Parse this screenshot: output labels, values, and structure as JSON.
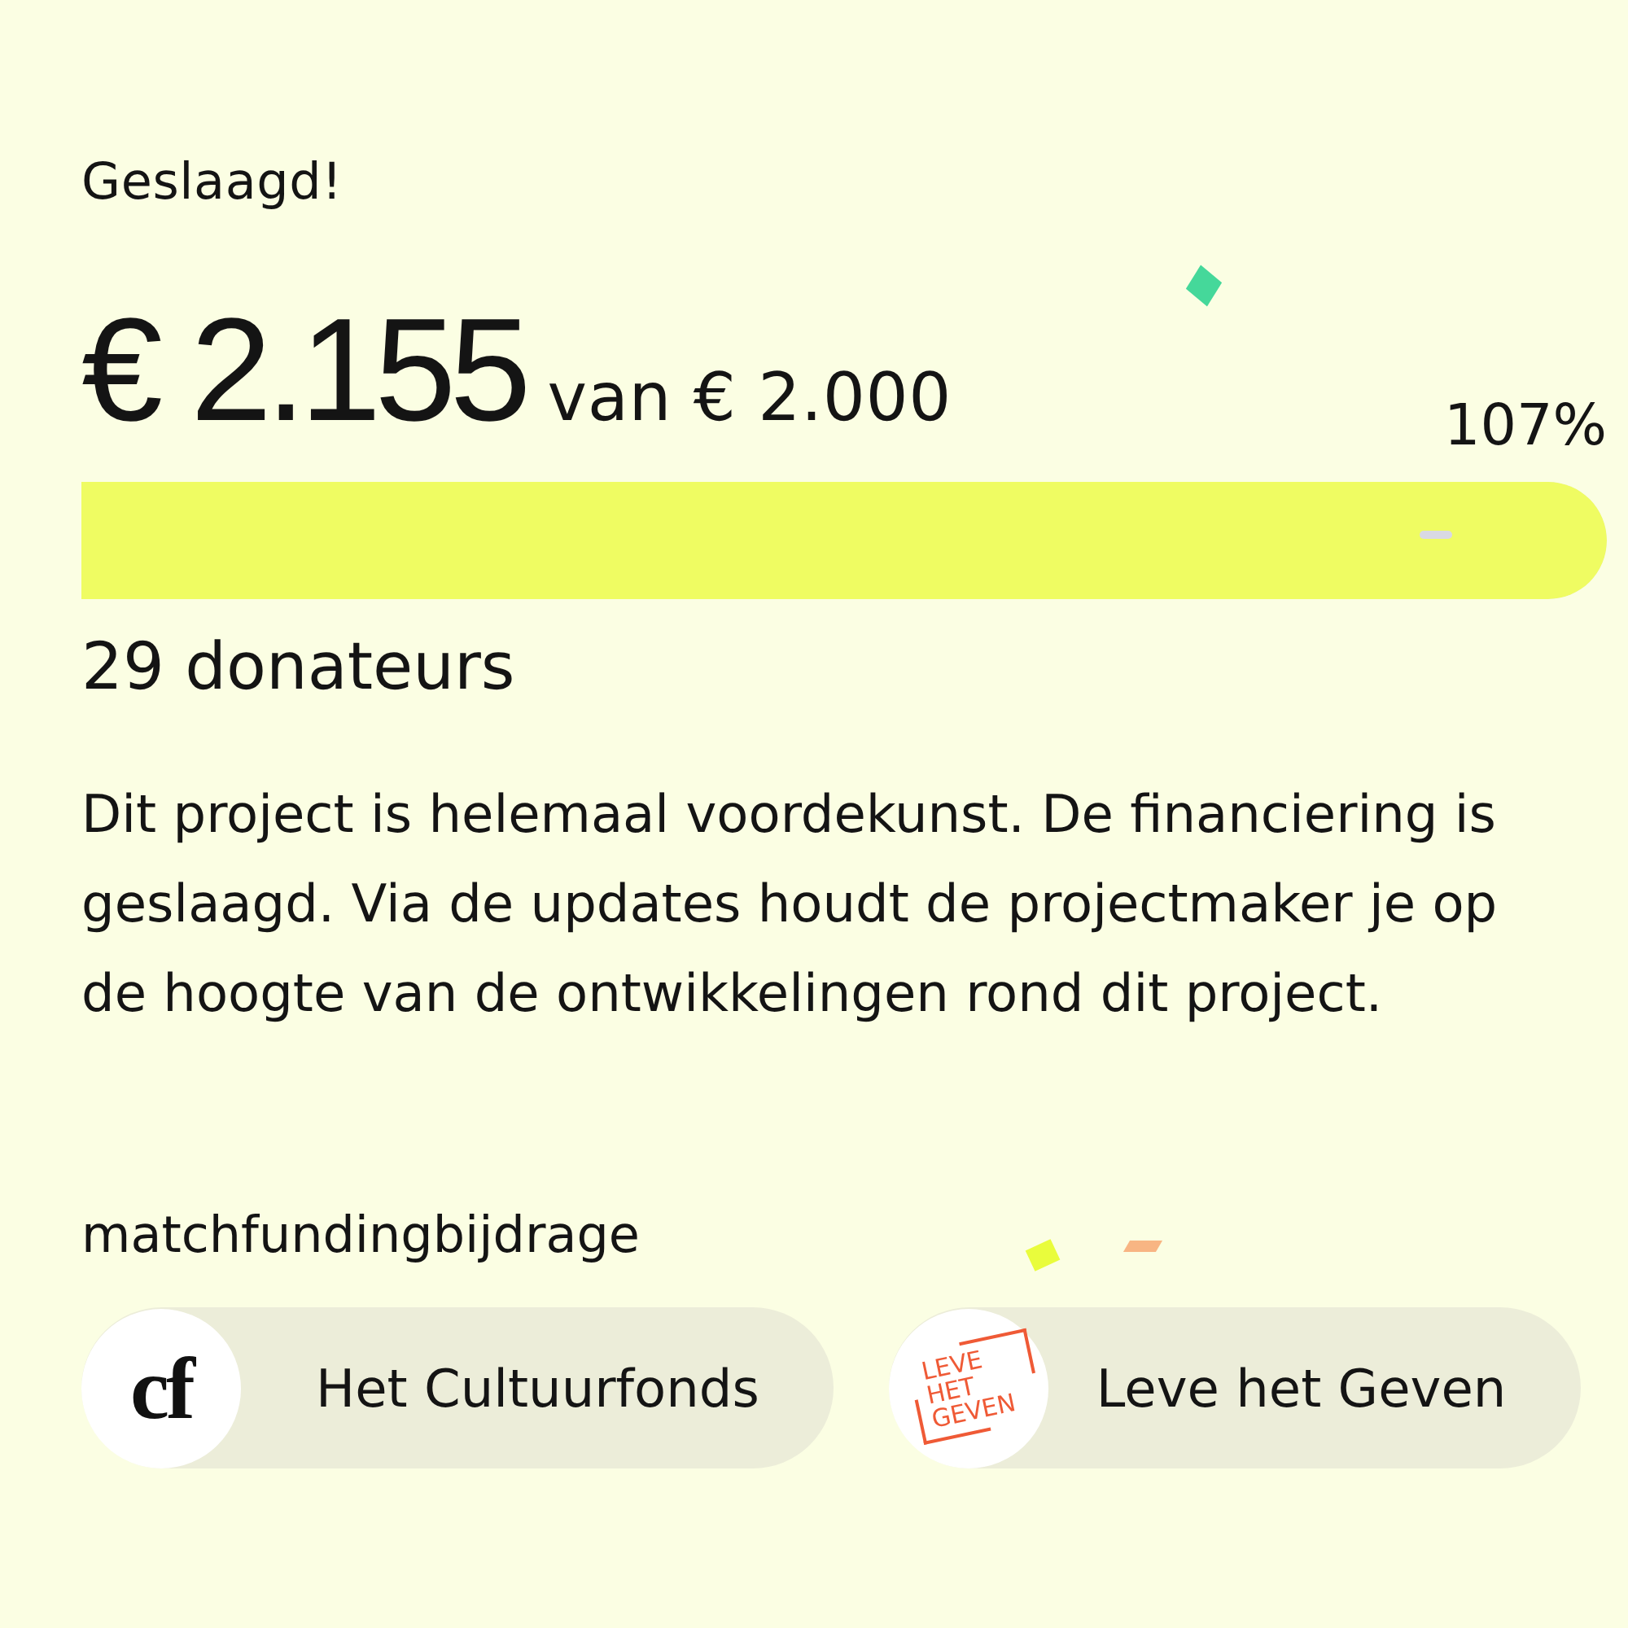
{
  "status": "Geslaagd!",
  "funding": {
    "raised": "€ 2.155",
    "goal": "van € 2.000",
    "percent": "107%",
    "progress": {
      "level": 1
    }
  },
  "donors": "29 donateurs",
  "description": "Dit project is helemaal voordekunst. De financiering is geslaagd. Via de updates houdt de projectmaker je op de hoogte van de ontwikkelingen rond dit project.",
  "matchfunding": {
    "title": "matchfundingbijdrage",
    "funders": [
      {
        "kind": "monogram",
        "logo_text": [
          "cf"
        ],
        "name": "Het Cultuurfonds"
      },
      {
        "kind": "stamp",
        "logo_text": [
          "LEVE",
          "HET",
          "GEVEN"
        ],
        "name": "Leve het Geven"
      }
    ]
  }
}
